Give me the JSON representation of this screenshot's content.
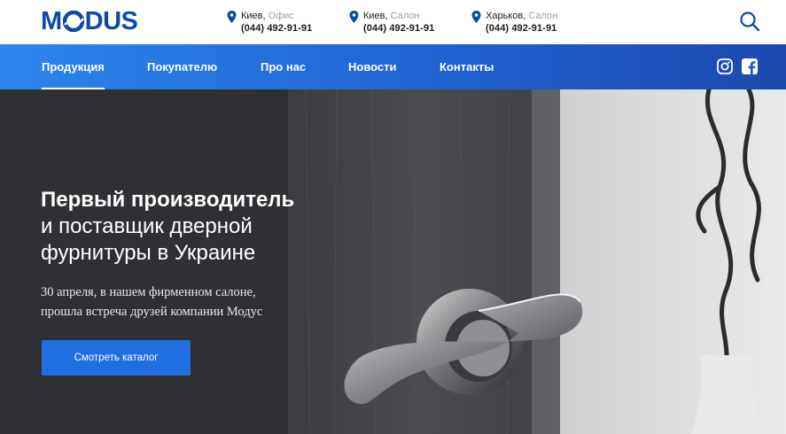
{
  "brand": {
    "logo_left": "M",
    "logo_right": "DUS",
    "color": "#0d4aa8"
  },
  "contacts": [
    {
      "city": "Киев,",
      "type": "Офис",
      "phone": "(044) 492-91-91"
    },
    {
      "city": "Киев,",
      "type": "Салон",
      "phone": "(044) 492-91-91"
    },
    {
      "city": "Харьков,",
      "type": "Салон",
      "phone": "(044) 492-91-91"
    }
  ],
  "icons": {
    "search": "search-icon",
    "pin": "map-pin-icon",
    "instagram": "instagram-icon",
    "facebook": "facebook-icon"
  },
  "nav": {
    "items": [
      {
        "label": "Продукция",
        "active": true
      },
      {
        "label": "Покупателю",
        "active": false
      },
      {
        "label": "Про нас",
        "active": false
      },
      {
        "label": "Новости",
        "active": false
      },
      {
        "label": "Контакты",
        "active": false
      }
    ],
    "gradient": [
      "#2d86ee",
      "#1b49ae"
    ]
  },
  "hero": {
    "title_line1": "Первый производитель",
    "title_line2": "и поставщик дверной",
    "title_line3": "фурнитуры в Украине",
    "subtitle_line1": "30 апреля, в нашем фирменном салоне,",
    "subtitle_line2": "прошла встреча друзей компании Модус",
    "cta_label": "Смотреть каталог",
    "cta_color": "#1f6fe0"
  }
}
